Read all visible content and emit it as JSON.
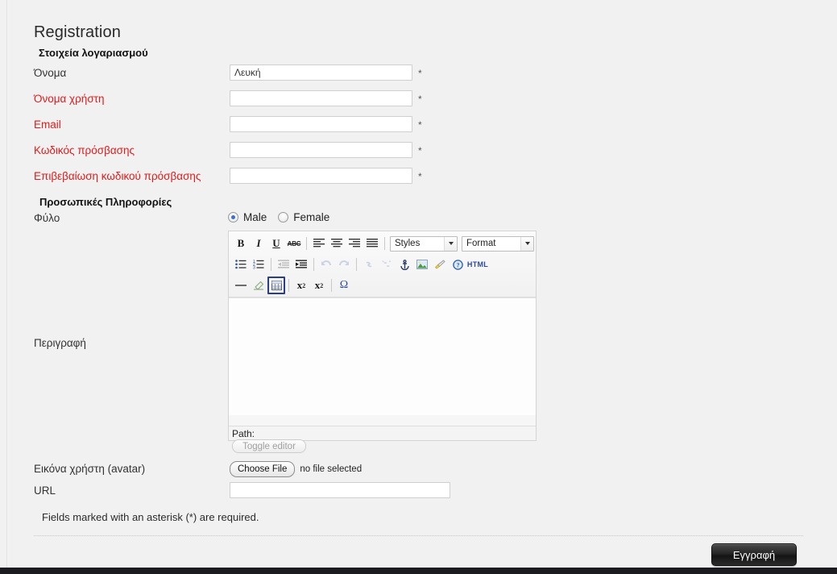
{
  "page": {
    "title": "Registration"
  },
  "sections": {
    "account": "Στοιχεία λογαριασμού",
    "personal": "Προσωπικές Πληροφορίες"
  },
  "fields": {
    "name": {
      "label": "Όνομα",
      "value": "Λευκή",
      "required_mark": "*"
    },
    "username": {
      "label": "Όνομα χρήστη",
      "value": "",
      "required_mark": "*"
    },
    "email": {
      "label": "Email",
      "value": "",
      "required_mark": "*"
    },
    "password": {
      "label": "Κωδικός πρόσβασης",
      "value": "",
      "required_mark": "*"
    },
    "password_confirm": {
      "label": "Επιβεβαίωση κωδικού πρόσβασης",
      "value": "",
      "required_mark": "*"
    },
    "gender": {
      "label": "Φύλο",
      "options": [
        "Male",
        "Female"
      ],
      "selected": "Male"
    },
    "description": {
      "label": "Περιγραφή",
      "value": ""
    },
    "avatar": {
      "label": "Εικόνα χρήστη (avatar)",
      "button_label": "Choose File",
      "status": "no file selected"
    },
    "url": {
      "label": "URL",
      "value": ""
    }
  },
  "editor": {
    "styles_combo": "Styles",
    "format_combo": "Format",
    "path_label": "Path:",
    "toggle_label": "Toggle editor",
    "toolbar_row1": [
      {
        "name": "bold",
        "glyph": "B"
      },
      {
        "name": "italic",
        "glyph": "I"
      },
      {
        "name": "underline",
        "glyph": "U"
      },
      {
        "name": "strikethrough",
        "glyph": "ABC"
      }
    ],
    "toolbar_html_label": "HTML"
  },
  "footer": {
    "required_note": "Fields marked with an asterisk (*) are required.",
    "submit_label": "Εγγραφή"
  },
  "colors": {
    "background": "#f1f1f1",
    "required_label": "#e01b1b",
    "submit_button": "#262626",
    "radio_accent": "#3b6fd4",
    "editor_active_border": "#2a3e87",
    "html_label": "#2b4a9b"
  }
}
